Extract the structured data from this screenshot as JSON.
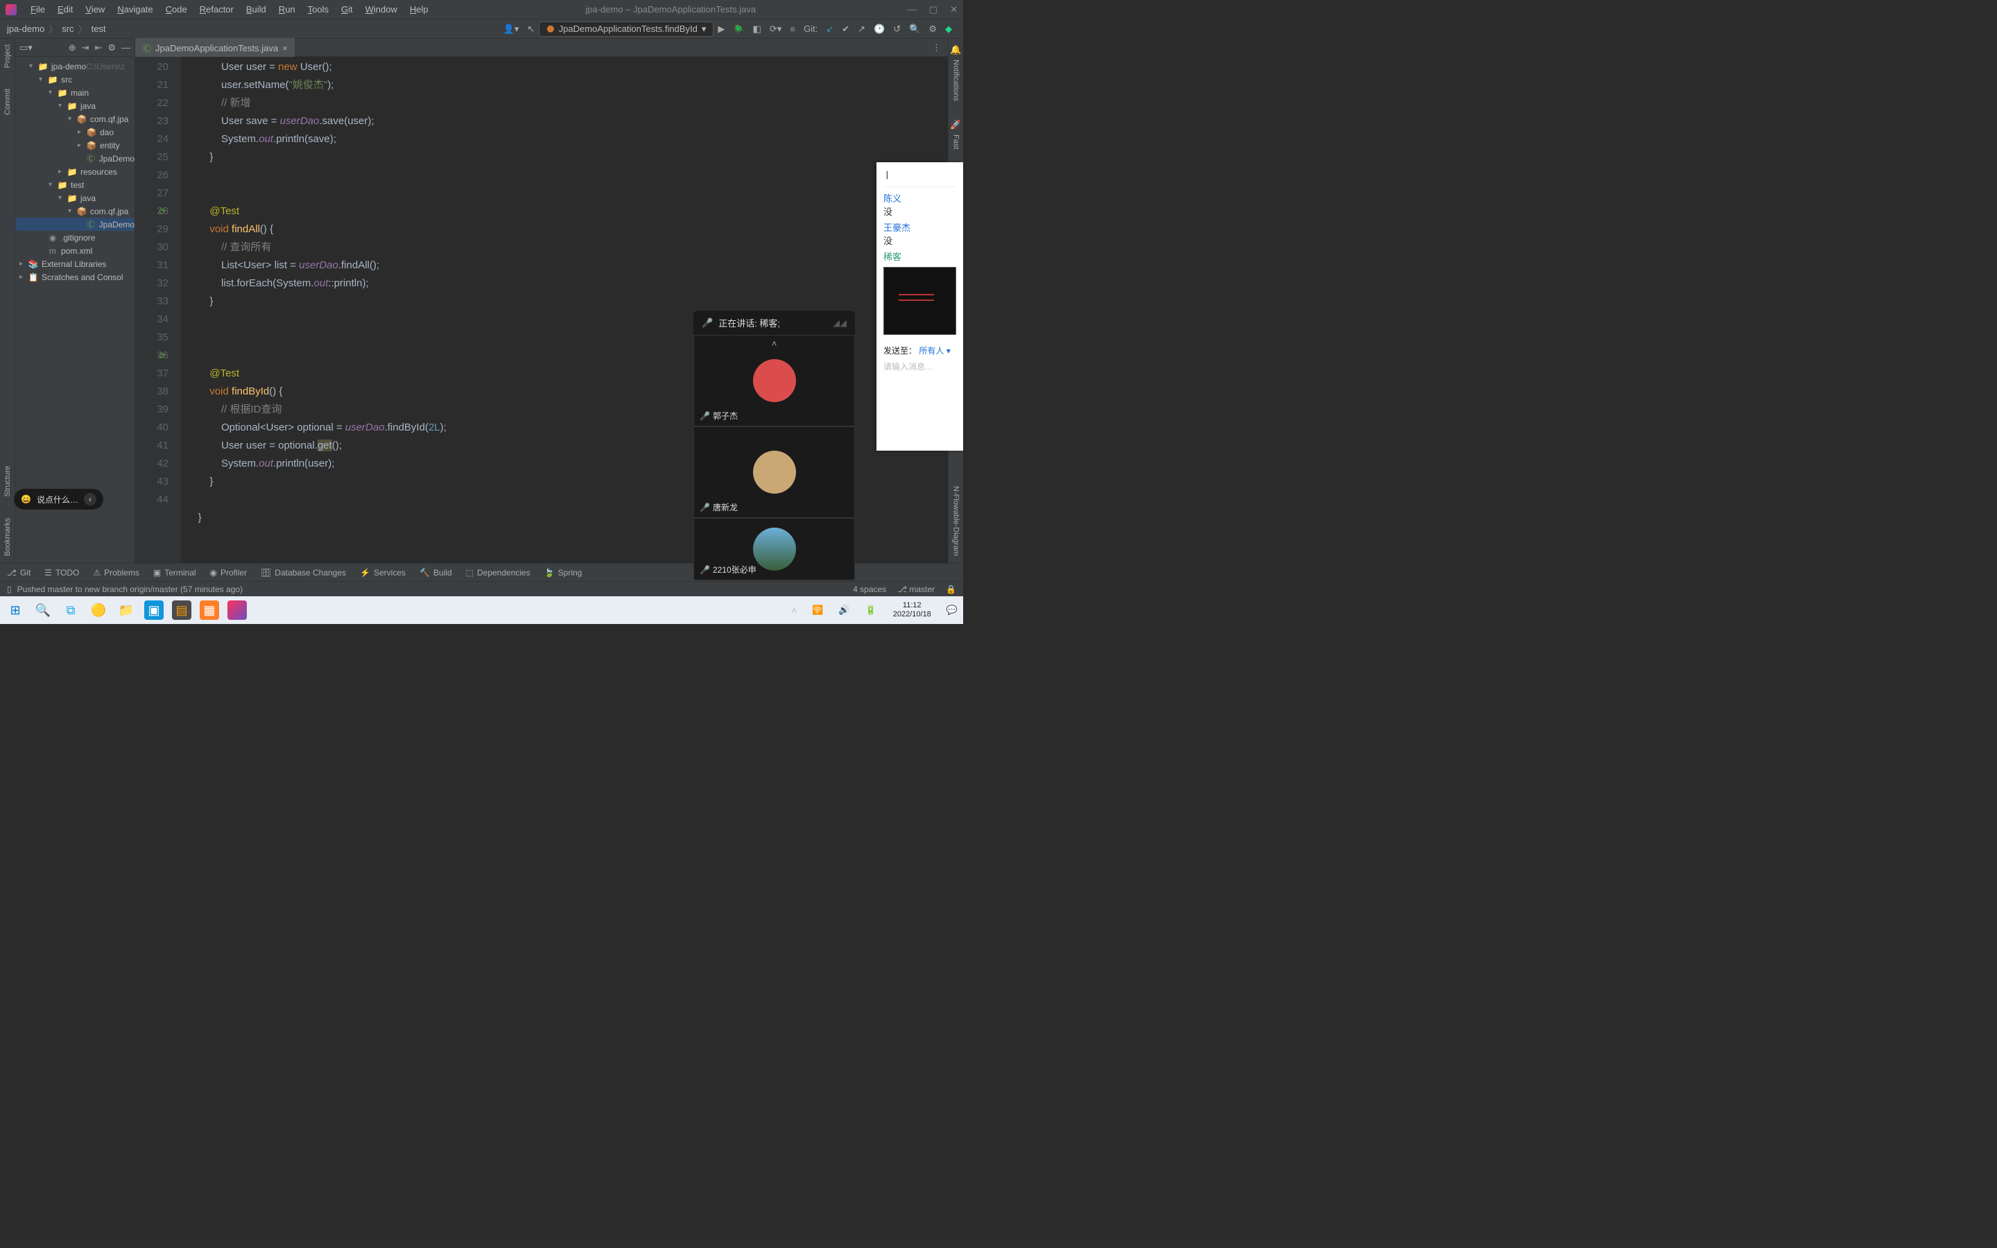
{
  "window": {
    "title": "jpa-demo – JpaDemoApplicationTests.java"
  },
  "menus": [
    "File",
    "Edit",
    "View",
    "Navigate",
    "Code",
    "Refactor",
    "Build",
    "Run",
    "Tools",
    "Git",
    "Window",
    "Help"
  ],
  "breadcrumb": [
    "jpa-demo",
    "src",
    "test"
  ],
  "runconfig": "JpaDemoApplicationTests.findById",
  "git_label": "Git:",
  "tab": {
    "name": "JpaDemoApplicationTests.java"
  },
  "tree": [
    {
      "d": 1,
      "a": "▾",
      "i": "📁",
      "t": "jpa-demo",
      "extra": " C:\\Users\\z"
    },
    {
      "d": 2,
      "a": "▾",
      "i": "📁",
      "t": "src"
    },
    {
      "d": 3,
      "a": "▾",
      "i": "📁",
      "t": "main"
    },
    {
      "d": 4,
      "a": "▾",
      "i": "📁",
      "t": "java",
      "cls": "src"
    },
    {
      "d": 5,
      "a": "▾",
      "i": "📦",
      "t": "com.qf.jpa"
    },
    {
      "d": 6,
      "a": "▸",
      "i": "📦",
      "t": "dao"
    },
    {
      "d": 6,
      "a": "▸",
      "i": "📦",
      "t": "entity"
    },
    {
      "d": 6,
      "a": "",
      "i": "Ⓒ",
      "t": "JpaDemo",
      "jf": true
    },
    {
      "d": 4,
      "a": "▸",
      "i": "📁",
      "t": "resources"
    },
    {
      "d": 3,
      "a": "▾",
      "i": "📁",
      "t": "test"
    },
    {
      "d": 4,
      "a": "▾",
      "i": "📁",
      "t": "java",
      "cls": "tst"
    },
    {
      "d": 5,
      "a": "▾",
      "i": "📦",
      "t": "com.qf.jpa"
    },
    {
      "d": 6,
      "a": "",
      "i": "Ⓒ",
      "t": "JpaDemo",
      "jf": true,
      "sel": true
    },
    {
      "d": 2,
      "a": "",
      "i": "◉",
      "t": ".gitignore"
    },
    {
      "d": 2,
      "a": "",
      "i": "m",
      "t": "pom.xml"
    },
    {
      "d": 0,
      "a": "▸",
      "i": "📚",
      "t": "External Libraries"
    },
    {
      "d": 0,
      "a": "▸",
      "i": "📋",
      "t": "Scratches and Consol"
    }
  ],
  "lines_start": 20,
  "lines_end": 44,
  "code_raw": "            User user = <kw>new</kw> User();\n            user.setName(<str>\"姚俊杰\"</str>);\n            <comm>// 新增</comm>\n            User save = <field>userDao</field>.save(user);\n            System.<field>out</field>.println(save);\n        }\n\n\n        <ann>@Test</ann>\n        <kw>void</kw> <meth>findAll</meth>() {\n            <comm>// 查询所有</comm>\n            List<User> list = <field>userDao</field>.findAll();\n            list.forEach(System.<field>out</field>::println);\n        }\n\n\n\n        <ann>@Test</ann>\n        <kw>void</kw> <meth>findById</meth>() {\n            <comm>// 根据ID查询</comm>\n            Optional<User> optional = <field>userDao</field>.findById(<num>2L</num>);\n            User user = optional.<warn>get</warn>();\n            System.<field>out</field>.println(user);\n        }\n\n    }\n",
  "bottom": [
    "Git",
    "TODO",
    "Problems",
    "Terminal",
    "Profiler",
    "Database Changes",
    "Services",
    "Build",
    "Dependencies",
    "Spring"
  ],
  "status": {
    "msg": "Pushed master to new branch origin/master (57 minutes ago)",
    "spaces": "4 spaces",
    "branch": "master"
  },
  "voice": {
    "speaking": "正在讲话: 稀客;",
    "p1": "郭子杰",
    "p2": "唐新龙",
    "p3": "2210张必申"
  },
  "chat": {
    "n1": "陈义",
    "m1": "没",
    "n2": "王豪杰",
    "m2": "没",
    "n3": "稀客",
    "sendlabel": "发送至：",
    "sendto": "所有人 ▾",
    "placeholder": "请输入消息…"
  },
  "bubble": "说点什么…",
  "clock": {
    "time": "11:12",
    "date": "2022/10/18"
  },
  "sidebars": {
    "project": "Project",
    "commit": "Commit",
    "structure": "Structure",
    "bookmarks": "Bookmarks",
    "notifications": "Notifications",
    "fast": "Fast",
    "flowable": "N-Flowable-Diagram"
  }
}
